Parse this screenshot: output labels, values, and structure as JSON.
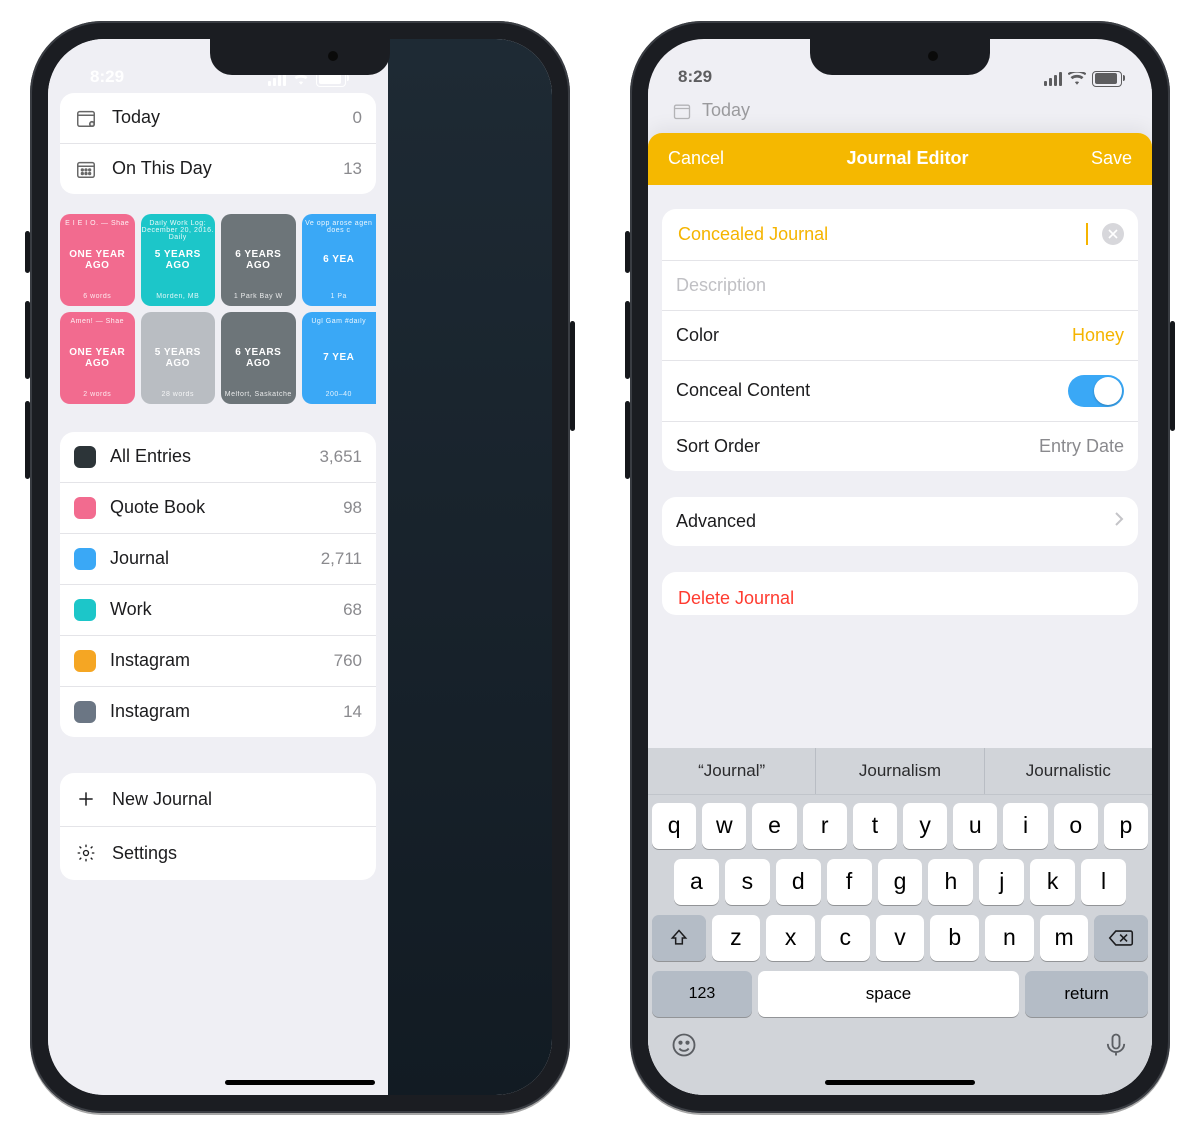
{
  "status": {
    "time": "8:29"
  },
  "left": {
    "today": {
      "label": "Today",
      "count": "0"
    },
    "on_this_day": {
      "label": "On This Day",
      "count": "13"
    },
    "memories": [
      {
        "top": "E I E I O. — Shae",
        "ago": "ONE YEAR AGO",
        "bot": "6 words",
        "color": "pink"
      },
      {
        "top": "Daily Work Log: December 20, 2016. Daily",
        "ago": "5 YEARS AGO",
        "bot": "Morden, MB",
        "color": "teal"
      },
      {
        "top": "",
        "ago": "6 YEARS AGO",
        "bot": "1 Park Bay W",
        "color": "photo"
      },
      {
        "top": "Ve opp arose agen does c",
        "ago": "6 YEA",
        "bot": "1 Pa",
        "color": "sky"
      },
      {
        "top": "Amen! — Shae",
        "ago": "ONE YEAR AGO",
        "bot": "2 words",
        "color": "pink"
      },
      {
        "top": "",
        "ago": "5 YEARS AGO",
        "bot": "28 words",
        "color": "grey"
      },
      {
        "top": "",
        "ago": "6 YEARS AGO",
        "bot": "Melfort, Saskatche",
        "color": "photo"
      },
      {
        "top": "Ugl Gam #daily",
        "ago": "7 YEA",
        "bot": "200–40",
        "color": "sky"
      }
    ],
    "journals": [
      {
        "name": "All Entries",
        "count": "3,651",
        "color": "#2c3438"
      },
      {
        "name": "Quote Book",
        "count": "98",
        "color": "#f26b8f"
      },
      {
        "name": "Journal",
        "count": "2,711",
        "color": "#3aa8f6"
      },
      {
        "name": "Work",
        "count": "68",
        "color": "#1cc6c9"
      },
      {
        "name": "Instagram",
        "count": "760",
        "color": "#f5a623"
      },
      {
        "name": "Instagram",
        "count": "14",
        "color": "#6b7684"
      }
    ],
    "actions": {
      "new_journal": "New Journal",
      "settings": "Settings"
    }
  },
  "right": {
    "faded_today": "Today",
    "header": {
      "cancel": "Cancel",
      "title": "Journal Editor",
      "save": "Save"
    },
    "fields": {
      "name_value": "Concealed Journal",
      "description_placeholder": "Description",
      "color_label": "Color",
      "color_value": "Honey",
      "conceal_label": "Conceal Content",
      "conceal_on": true,
      "sort_label": "Sort Order",
      "sort_value": "Entry Date",
      "advanced_label": "Advanced",
      "delete_label": "Delete Journal"
    },
    "keyboard": {
      "suggestions": [
        "“Journal”",
        "Journalism",
        "Journalistic"
      ],
      "row1": [
        "q",
        "w",
        "e",
        "r",
        "t",
        "y",
        "u",
        "i",
        "o",
        "p"
      ],
      "row2": [
        "a",
        "s",
        "d",
        "f",
        "g",
        "h",
        "j",
        "k",
        "l"
      ],
      "row3": [
        "z",
        "x",
        "c",
        "v",
        "b",
        "n",
        "m"
      ],
      "numbers": "123",
      "space": "space",
      "return": "return"
    }
  }
}
